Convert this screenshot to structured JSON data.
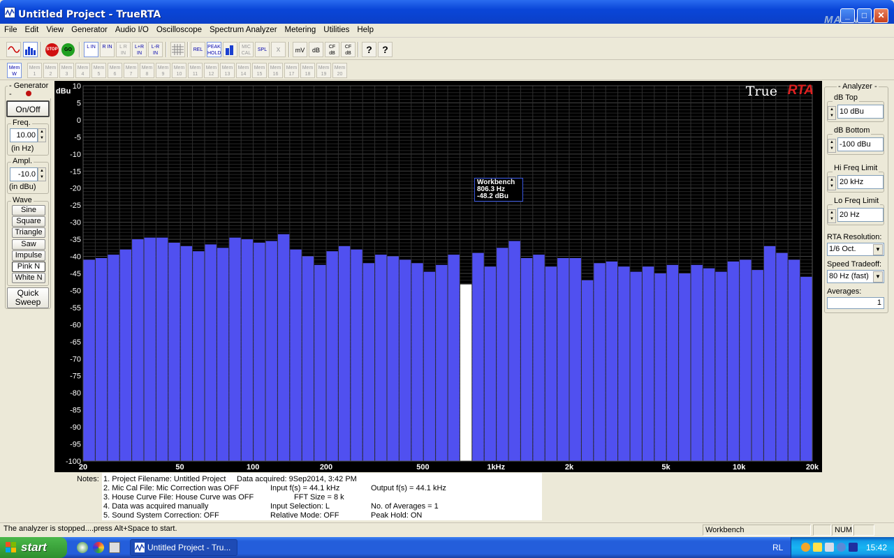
{
  "window": {
    "title": "Untitled Project - TrueRTA",
    "watermark": "MAGNUM"
  },
  "menu": [
    "File",
    "Edit",
    "View",
    "Generator",
    "Audio I/O",
    "Oscilloscope",
    "Spectrum Analyzer",
    "Metering",
    "Utilities",
    "Help"
  ],
  "toolbar": {
    "buttons": [
      {
        "label": "~",
        "icon": "sine-wave-icon"
      },
      {
        "label": "",
        "icon": "spectrum-icon"
      },
      {
        "label": "STOP",
        "icon": "stop-icon"
      },
      {
        "label": "GO",
        "icon": "go-icon"
      },
      {
        "label": "L IN",
        "icon": "left-in-icon"
      },
      {
        "label": "R IN",
        "icon": "right-in-icon"
      },
      {
        "label": "L R IN",
        "icon": "lr-in-icon"
      },
      {
        "label": "L+R IN",
        "icon": "l-plus-r-icon"
      },
      {
        "label": "L-R IN",
        "icon": "l-minus-r-icon"
      },
      {
        "label": "#",
        "icon": "grid-icon"
      },
      {
        "label": "REL",
        "icon": "rel-icon"
      },
      {
        "label": "PEAK HOLD",
        "icon": "peak-hold-icon"
      },
      {
        "label": "",
        "icon": "bars-icon"
      },
      {
        "label": "MIC CAL",
        "icon": "mic-cal-icon"
      },
      {
        "label": "SPL",
        "icon": "spl-icon"
      },
      {
        "label": "x",
        "icon": "clear-icon"
      },
      {
        "label": "mV",
        "icon": "mv-icon"
      },
      {
        "label": "dB",
        "icon": "db-icon"
      },
      {
        "label": "CF dB",
        "icon": "cf-db-icon"
      },
      {
        "label": "CF dB",
        "icon": "cf-db2-icon"
      },
      {
        "label": "?",
        "icon": "help-icon"
      },
      {
        "label": "?",
        "icon": "context-help-icon"
      }
    ],
    "mem_w": "Mem W",
    "mems": [
      "1",
      "2",
      "3",
      "4",
      "5",
      "6",
      "7",
      "8",
      "9",
      "10",
      "11",
      "12",
      "13",
      "14",
      "15",
      "16",
      "17",
      "18",
      "19",
      "20"
    ]
  },
  "generator": {
    "title": "- Generator -",
    "onoff": "On/Off",
    "freq_label": "Freq.",
    "freq_value": "10.00",
    "freq_unit": "(in Hz)",
    "ampl_label": "Ampl.",
    "ampl_value": "-10.0",
    "ampl_unit": "(in dBu)",
    "wave_label": "Wave",
    "waves": [
      "Sine",
      "Square",
      "Triangle",
      "Saw",
      "Impulse",
      "Pink N",
      "White N"
    ],
    "quick_sweep": "Quick Sweep"
  },
  "analyzer": {
    "title": "- Analyzer -",
    "db_top_label": "dB Top",
    "db_top": "10 dBu",
    "db_bottom_label": "dB Bottom",
    "db_bottom": "-100 dBu",
    "hi_label": "Hi Freq Limit",
    "hi": "20 kHz",
    "lo_label": "Lo Freq Limit",
    "lo": "20 Hz",
    "res_label": "RTA Resolution:",
    "res": "1/6 Oct.",
    "speed_label": "Speed Tradeoff:",
    "speed": "80 Hz (fast)",
    "avg_label": "Averages:",
    "avg": "1"
  },
  "chart_data": {
    "type": "bar",
    "ylabel": "dBu",
    "ylim": [
      -100,
      10
    ],
    "x_scale": "log",
    "xlim": [
      20,
      20000
    ],
    "yticks": [
      10,
      5,
      0,
      -5,
      -10,
      -15,
      -20,
      -25,
      -30,
      -35,
      -40,
      -45,
      -50,
      -55,
      -60,
      -65,
      -70,
      -75,
      -80,
      -85,
      -90,
      -95,
      -100
    ],
    "xticks": [
      {
        "f": 20,
        "label": "20"
      },
      {
        "f": 50,
        "label": "50"
      },
      {
        "f": 100,
        "label": "100"
      },
      {
        "f": 200,
        "label": "200"
      },
      {
        "f": 500,
        "label": "500"
      },
      {
        "f": 1000,
        "label": "1kHz"
      },
      {
        "f": 2000,
        "label": "2k"
      },
      {
        "f": 5000,
        "label": "5k"
      },
      {
        "f": 10000,
        "label": "10k"
      },
      {
        "f": 20000,
        "label": "20k"
      }
    ],
    "bar_color": "#5050f0",
    "highlight_color": "#ffffff",
    "highlight_index": 31,
    "values": [
      -41,
      -40.5,
      -39.5,
      -38,
      -35,
      -34.5,
      -34.5,
      -36,
      -37,
      -38.5,
      -36.5,
      -37.5,
      -34.5,
      -35,
      -36,
      -35.5,
      -33.5,
      -38,
      -40,
      -42.5,
      -38.5,
      -37,
      -38,
      -42,
      -39.5,
      -40,
      -41,
      -42,
      -44.5,
      -42.5,
      -39.5,
      -48.2,
      -39,
      -43,
      -37.5,
      -35.5,
      -40.5,
      -39.5,
      -43,
      -40.5,
      -40.5,
      -47,
      -42,
      -41.5,
      -43,
      -44.5,
      -43,
      -45,
      -42.5,
      -45,
      -42.5,
      -43.5,
      -44.5,
      -41.5,
      -41,
      -44,
      -37,
      -39,
      -41,
      -46
    ],
    "logo_true": "True",
    "logo_rta": "RTA",
    "tooltip": {
      "name": "Workbench",
      "freq": "806.3 Hz",
      "level": "-48.2 dBu"
    }
  },
  "notes": {
    "label": "Notes:",
    "lines": [
      [
        "1. Project Filename: Untitled Project",
        "Data acquired: 9Sep2014, 3:42 PM",
        ""
      ],
      [
        "2. Mic Cal File: Mic Correction was OFF",
        "Input f(s) = 44.1 kHz",
        "Output f(s) = 44.1 kHz"
      ],
      [
        "3. House Curve File: House Curve was OFF",
        "FFT Size = 8 k",
        ""
      ],
      [
        "4. Data was acquired manually",
        "Input Selection: L",
        "No. of Averages = 1"
      ],
      [
        "5. Sound System Correction: OFF",
        "Relative Mode:  OFF",
        "Peak Hold: ON"
      ]
    ]
  },
  "status": {
    "message": "The analyzer is stopped....press Alt+Space to start.",
    "profile": "Workbench",
    "num": "NUM"
  },
  "taskbar": {
    "start": "start",
    "task": "Untitled Project - Tru...",
    "lang": "RL",
    "time": "15:42"
  }
}
